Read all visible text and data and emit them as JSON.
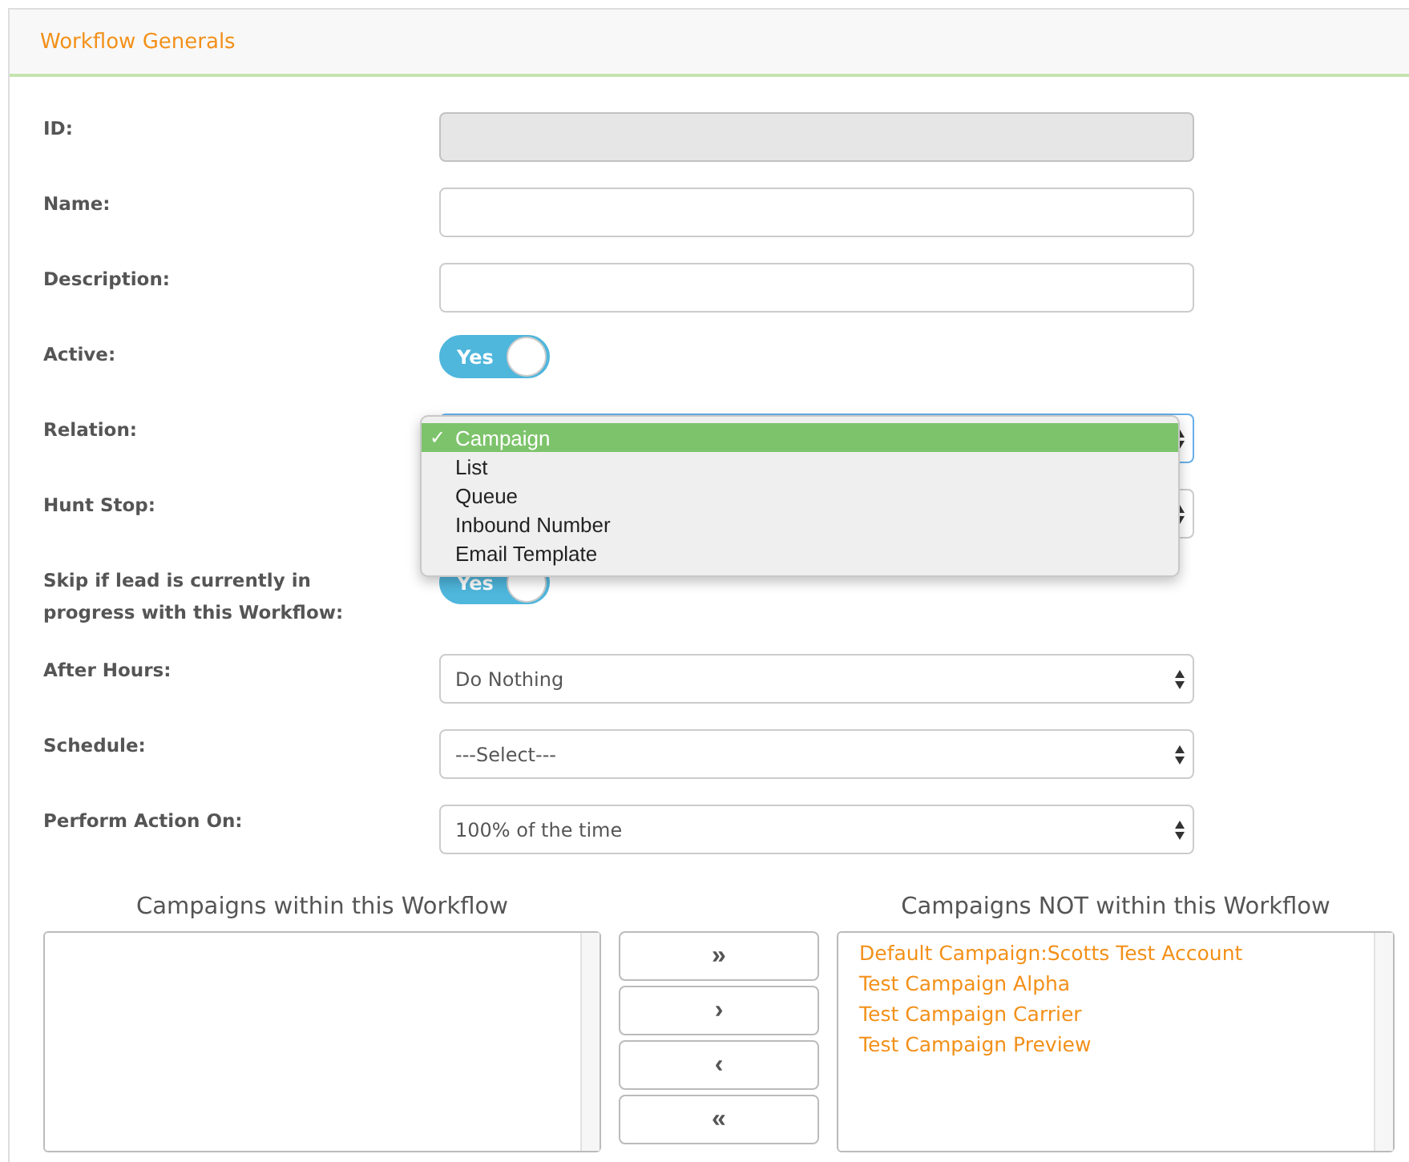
{
  "panel": {
    "title": "Workflow Generals"
  },
  "fields": [
    {
      "kind": "text",
      "label": "ID:",
      "disabled": true
    },
    {
      "kind": "text",
      "label": "Name:",
      "disabled": false
    },
    {
      "kind": "text",
      "label": "Description:",
      "disabled": false
    },
    {
      "kind": "toggle",
      "label": "Active:",
      "on": true,
      "text": "Yes"
    },
    {
      "kind": "select",
      "label": "Relation:",
      "open": true,
      "check": "✓",
      "options": [
        {
          "label": "Campaign",
          "selected": true
        },
        {
          "label": "List",
          "selected": false
        },
        {
          "label": "Queue",
          "selected": false
        },
        {
          "label": "Inbound Number",
          "selected": false
        },
        {
          "label": "Email Template",
          "selected": false
        }
      ]
    },
    {
      "kind": "select",
      "label": "Hunt Stop:",
      "open": false
    },
    {
      "kind": "toggle",
      "label": "Skip if lead is currently in progress with this Workflow:",
      "on": true,
      "text": "Yes"
    },
    {
      "kind": "select",
      "label": "After Hours:",
      "value": "Do Nothing",
      "open": false
    },
    {
      "kind": "select",
      "label": "Schedule:",
      "value": "---Select---",
      "open": false
    },
    {
      "kind": "select",
      "label": "Perform Action On:",
      "value": "100% of the time",
      "open": false
    }
  ],
  "lists": {
    "left": {
      "title": "Campaigns within this Workflow"
    },
    "buttons": [
      "»",
      "›",
      "‹",
      "«"
    ],
    "right": {
      "title": "Campaigns NOT within this Workflow",
      "items": [
        "Default Campaign:Scotts Test Account",
        "Test Campaign Alpha",
        "Test Campaign Carrier",
        "Test Campaign Preview"
      ]
    }
  }
}
